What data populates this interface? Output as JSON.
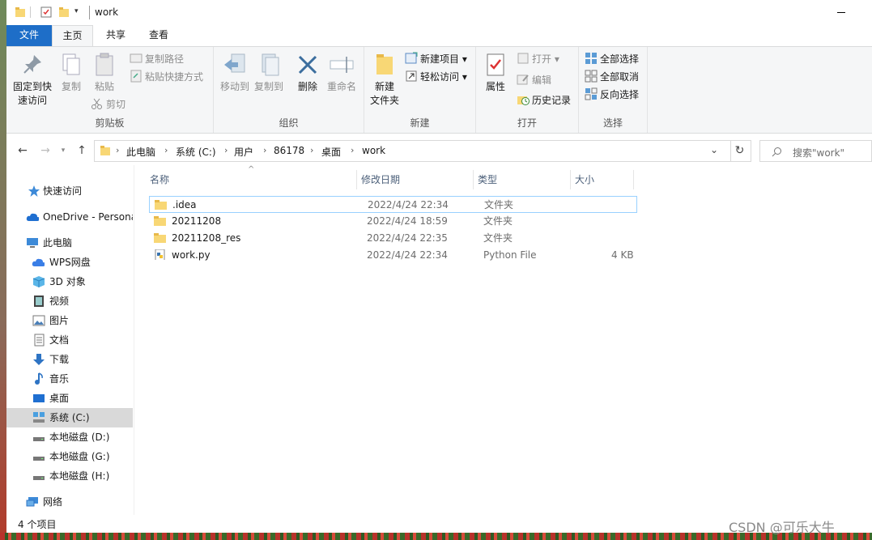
{
  "window": {
    "title": "work"
  },
  "ribbon_tabs": [
    "文件",
    "主页",
    "共享",
    "查看"
  ],
  "ribbon": {
    "clipboard": {
      "pin": "固定到快\n速访问",
      "pin_l1": "固定到快",
      "pin_l2": "速访问",
      "copy": "复制",
      "paste": "粘贴",
      "copy_path": "复制路径",
      "paste_shortcut": "粘贴快捷方式",
      "cut": "剪切",
      "label": "剪贴板"
    },
    "organize": {
      "move_to": "移动到",
      "copy_to": "复制到",
      "delete": "删除",
      "rename": "重命名",
      "label": "组织"
    },
    "new": {
      "new_folder_l1": "新建",
      "new_folder_l2": "文件夹",
      "new_item": "新建项目",
      "easy_access": "轻松访问",
      "label": "新建"
    },
    "open": {
      "properties": "属性",
      "open": "打开",
      "edit": "编辑",
      "history": "历史记录",
      "label": "打开"
    },
    "select": {
      "select_all": "全部选择",
      "select_none": "全部取消",
      "invert": "反向选择",
      "label": "选择"
    }
  },
  "address": {
    "crumbs": [
      "此电脑",
      "系统 (C:)",
      "用户",
      "86178",
      "桌面",
      "work"
    ],
    "search_placeholder": "搜索\"work\""
  },
  "sidebar": {
    "items": [
      {
        "label": "快速访问",
        "icon": "star-icon"
      },
      {
        "label": "OneDrive - Personal",
        "icon": "cloud-icon"
      },
      {
        "label": "此电脑",
        "icon": "computer-icon"
      },
      {
        "label": "WPS网盘",
        "icon": "wps-cloud-icon"
      },
      {
        "label": "3D 对象",
        "icon": "cube-icon"
      },
      {
        "label": "视频",
        "icon": "video-icon"
      },
      {
        "label": "图片",
        "icon": "picture-icon"
      },
      {
        "label": "文档",
        "icon": "document-icon"
      },
      {
        "label": "下载",
        "icon": "download-icon"
      },
      {
        "label": "音乐",
        "icon": "music-icon"
      },
      {
        "label": "桌面",
        "icon": "desktop-icon"
      },
      {
        "label": "系统 (C:)",
        "icon": "drive-icon"
      },
      {
        "label": "本地磁盘 (D:)",
        "icon": "drive-icon"
      },
      {
        "label": "本地磁盘 (G:)",
        "icon": "drive-icon"
      },
      {
        "label": "本地磁盘 (H:)",
        "icon": "drive-icon"
      },
      {
        "label": "网络",
        "icon": "network-icon"
      }
    ]
  },
  "columns": [
    "名称",
    "修改日期",
    "类型",
    "大小"
  ],
  "files": [
    {
      "name": ".idea",
      "date": "2022/4/24 22:34",
      "type": "文件夹",
      "size": "",
      "icon": "folder-icon"
    },
    {
      "name": "20211208",
      "date": "2022/4/24 18:59",
      "type": "文件夹",
      "size": "",
      "icon": "folder-icon"
    },
    {
      "name": "20211208_res",
      "date": "2022/4/24 22:35",
      "type": "文件夹",
      "size": "",
      "icon": "folder-icon"
    },
    {
      "name": "work.py",
      "date": "2022/4/24 22:34",
      "type": "Python File",
      "size": "4 KB",
      "icon": "python-file-icon"
    }
  ],
  "status": {
    "count": "4 个项目"
  },
  "watermark": "CSDN @可乐大牛"
}
